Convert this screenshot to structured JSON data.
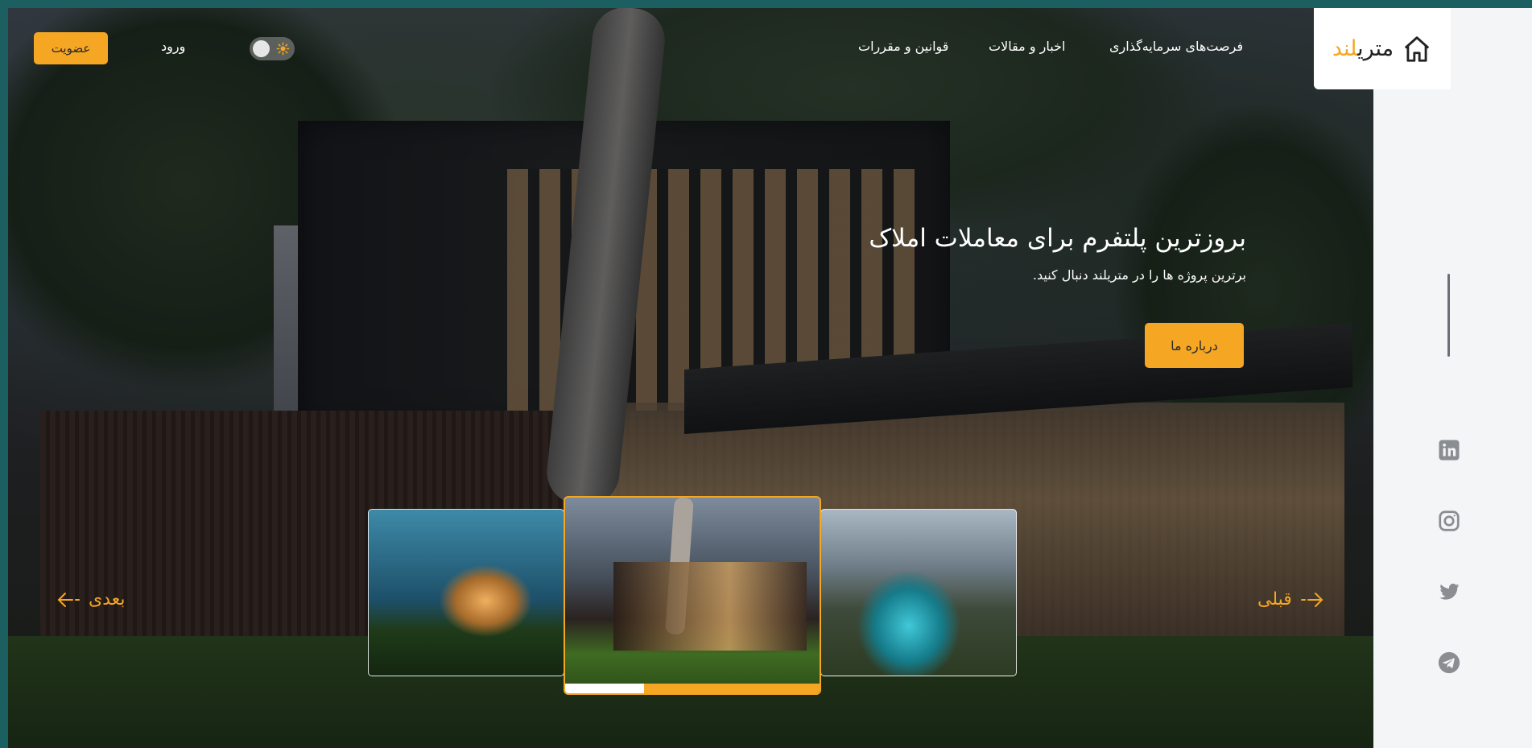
{
  "brand": {
    "name_dark": "متری",
    "name_accent": "لند"
  },
  "nav": {
    "links": [
      "فرصت‌های سرمایه‌گذاری",
      "اخبار و مقالات",
      "قوانین و مقررات"
    ],
    "login": "ورود",
    "join": "عضویت",
    "theme_toggle_icon": "sun-icon"
  },
  "hero": {
    "title": "بروزترین پلتفرم برای معاملات املاک",
    "subtitle": "برترین پروژه ها را در متریلند دنبال کنید.",
    "cta": "درباره ما"
  },
  "slider": {
    "prev_label": "قبلی",
    "next_label": "بعدی",
    "active_index": 1,
    "progress": 0.31
  },
  "social": [
    "linkedin-icon",
    "instagram-icon",
    "twitter-icon",
    "telegram-icon"
  ],
  "colors": {
    "accent": "#f5a623",
    "sidebar": "#f4f5f6",
    "border": "#1c5f61"
  }
}
